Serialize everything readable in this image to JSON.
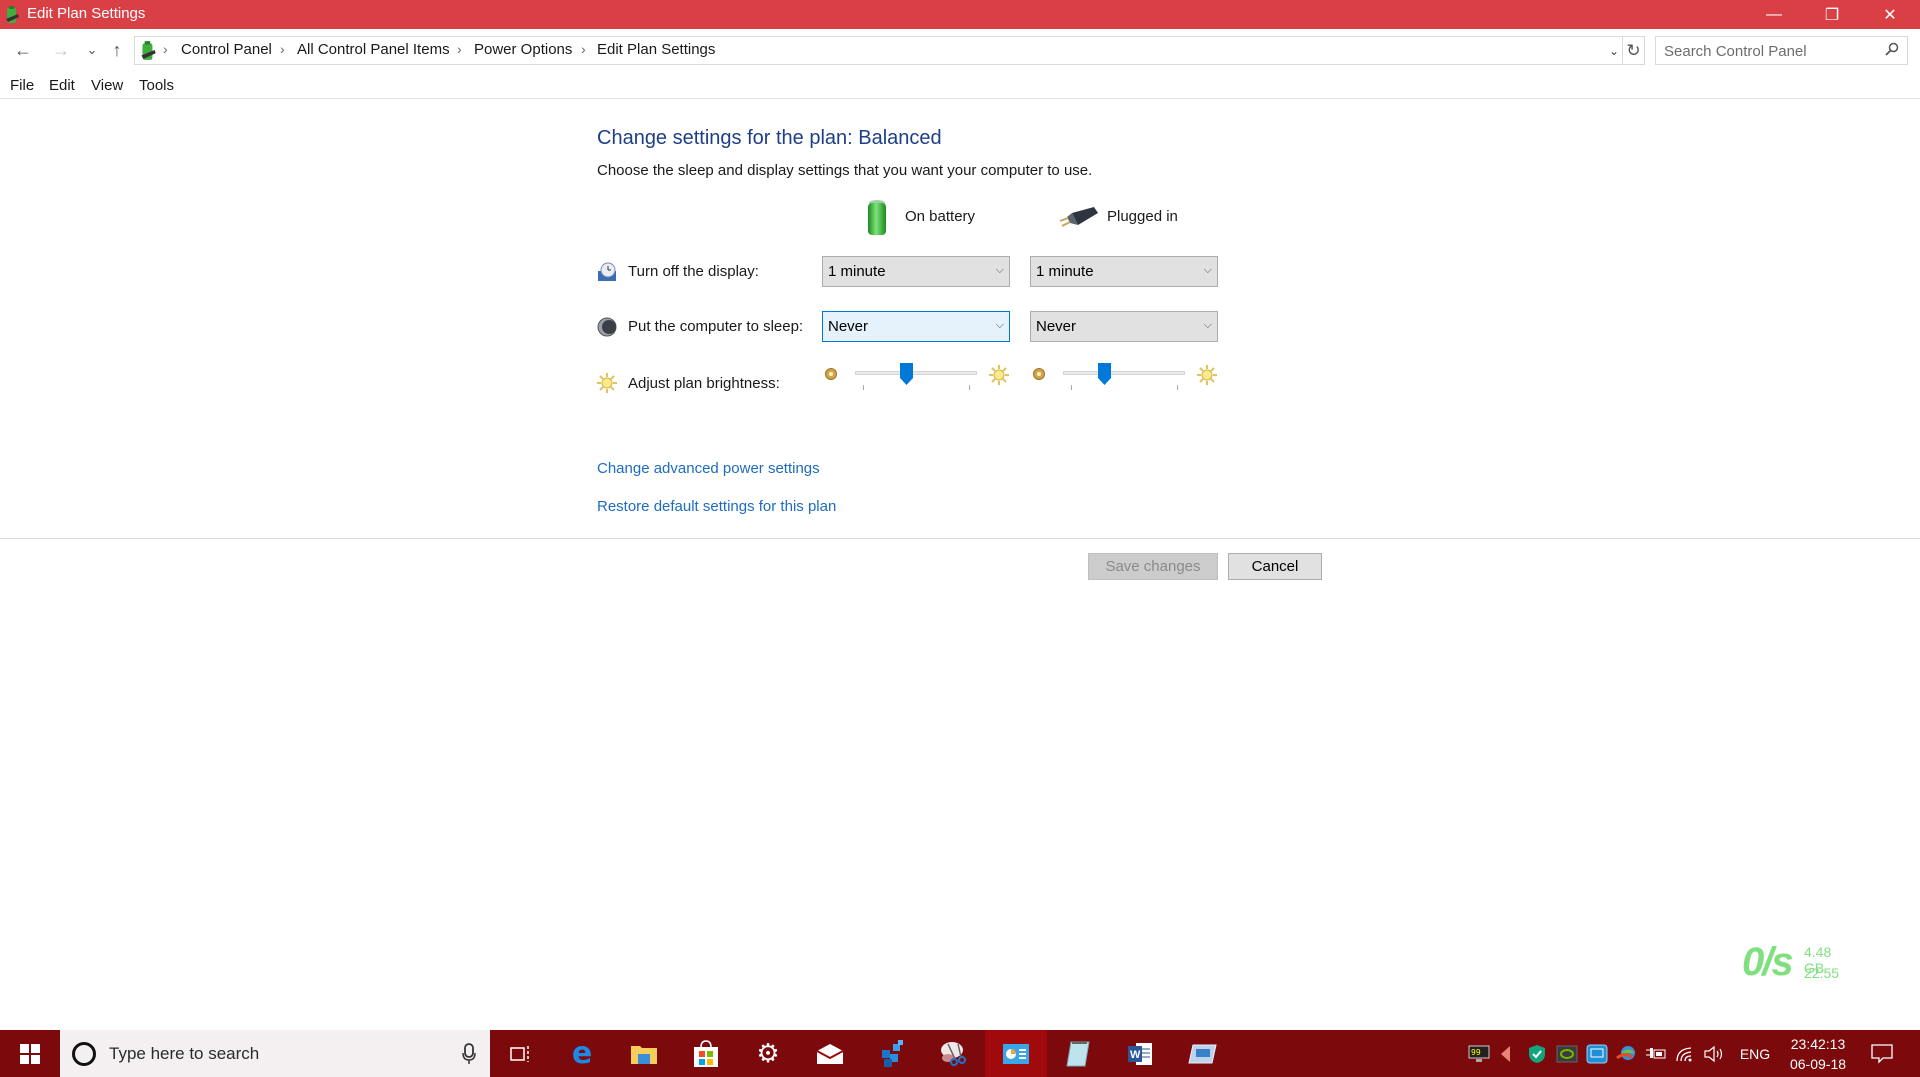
{
  "window": {
    "title": "Edit Plan Settings",
    "controls": {
      "minimize": "—",
      "restore": "❐",
      "close": "✕"
    }
  },
  "nav": {
    "back_icon": "←",
    "forward_icon": "→",
    "recent_icon": "⌄",
    "up_icon": "↑",
    "breadcrumbs": [
      "Control Panel",
      "All Control Panel Items",
      "Power Options",
      "Edit Plan Settings"
    ],
    "separator": "›",
    "dropdown_icon": "⌄",
    "refresh_icon": "↻"
  },
  "search": {
    "placeholder": "Search Control Panel",
    "value": "",
    "icon": "⚲"
  },
  "menu": [
    "File",
    "Edit",
    "View",
    "Tools"
  ],
  "content": {
    "heading": "Change settings for the plan: Balanced",
    "subtitle": "Choose the sleep and display settings that you want your computer to use.",
    "columns": {
      "battery": "On battery",
      "plugged": "Plugged in"
    },
    "rows": {
      "display": {
        "label": "Turn off the display:",
        "battery": "1 minute",
        "plugged": "1 minute"
      },
      "sleep": {
        "label": "Put the computer to sleep:",
        "battery": "Never",
        "plugged": "Never"
      },
      "brightness": {
        "label": "Adjust plan brightness:",
        "battery_percent": 41,
        "plugged_percent": 32
      }
    },
    "chevron": "⌵",
    "links": {
      "advanced": "Change advanced power settings",
      "restore": "Restore default settings for this plan"
    },
    "buttons": {
      "save": "Save changes",
      "cancel": "Cancel"
    }
  },
  "overlay": {
    "net_rate": "0/s",
    "memory": "4.48 GB",
    "time": "22:55"
  },
  "taskbar": {
    "search_placeholder": "Type here to search",
    "pinned": [
      "task-view",
      "edge",
      "file-explorer",
      "store",
      "settings",
      "mail",
      "app-blue-cubes",
      "snipping-tool",
      "control-panel",
      "notepad",
      "word",
      "remote-desktop"
    ],
    "active": "control-panel",
    "tray": {
      "language": "ENG"
    },
    "clock": {
      "time": "23:42:13",
      "date": "06-09-18"
    }
  },
  "colors": {
    "titlebar": "#d94046",
    "taskbar": "#7c0a0c",
    "heading": "#1e3f87",
    "link": "#1e6cc0",
    "accent": "#0078d7",
    "netmeter": "#7fe07f"
  }
}
